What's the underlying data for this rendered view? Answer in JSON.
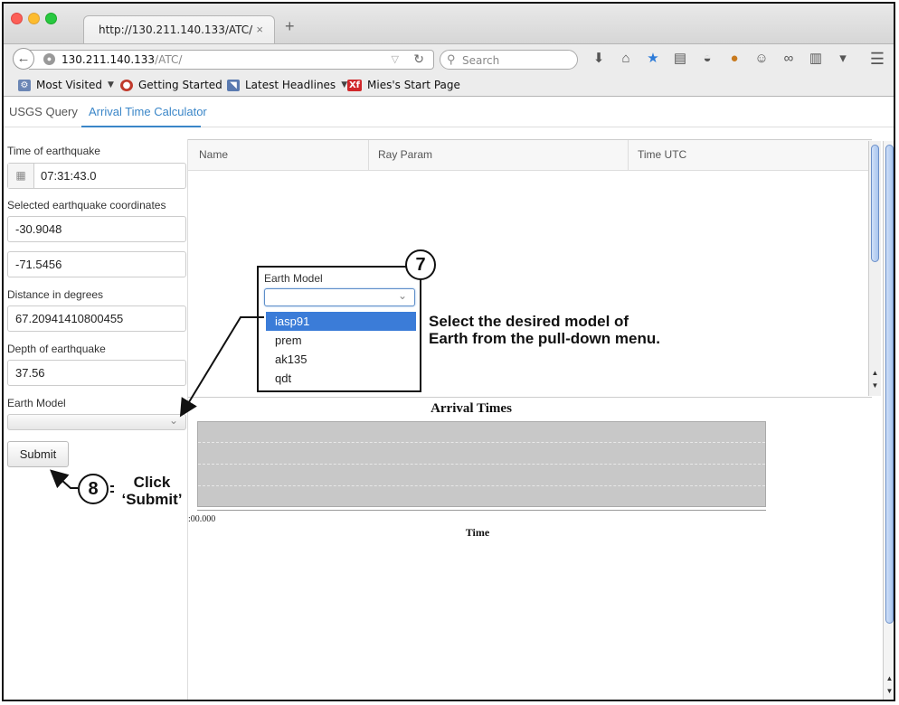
{
  "browser": {
    "tab_title": "http://130.211.140.133/ATC/",
    "tab_close": "×",
    "new_tab": "+",
    "url_host": "130.211.140.133",
    "url_path": "/ATC/",
    "search_placeholder": "Search"
  },
  "bookmarks": [
    {
      "label": "Most Visited",
      "icon": "gear-folder-icon",
      "caret": "▼"
    },
    {
      "label": "Getting Started",
      "icon": "firefox-icon"
    },
    {
      "label": "Latest Headlines",
      "icon": "rss-icon",
      "caret": "▼"
    },
    {
      "label": "Mies's Start Page",
      "icon": "xf-icon",
      "icon_text": "Xf"
    }
  ],
  "app_tabs": [
    {
      "label": "USGS Query",
      "active": false
    },
    {
      "label": "Arrival Time Calculator",
      "active": true
    }
  ],
  "form": {
    "time_label": "Time of earthquake",
    "time_value": "07:31:43.0",
    "coords_label": "Selected earthquake coordinates",
    "lat_value": "-30.9048",
    "lon_value": "-71.5456",
    "distance_label": "Distance in degrees",
    "distance_value": "67.20941410800455",
    "depth_label": "Depth of earthquake",
    "depth_value": "37.56",
    "model_label": "Earth Model",
    "submit_label": "Submit"
  },
  "table": {
    "columns": [
      "Name",
      "Ray Param",
      "Time UTC"
    ]
  },
  "chart": {
    "title": "Arrival Times",
    "x_tick": ":00.000",
    "xlabel": "Time"
  },
  "dropdown": {
    "label": "Earth Model",
    "options": [
      "iasp91",
      "prem",
      "ak135",
      "qdt"
    ],
    "highlighted": "iasp91"
  },
  "annotations": {
    "step7": "7",
    "step7_text_line1": "Select the desired model of",
    "step7_text_line2": "Earth from the pull-down menu.",
    "step8": "8",
    "step8_text_line1": "Click",
    "step8_text_line2": "‘Submit’"
  },
  "colors": {
    "accent": "#3a86c8",
    "selection": "#3b7cd8"
  }
}
